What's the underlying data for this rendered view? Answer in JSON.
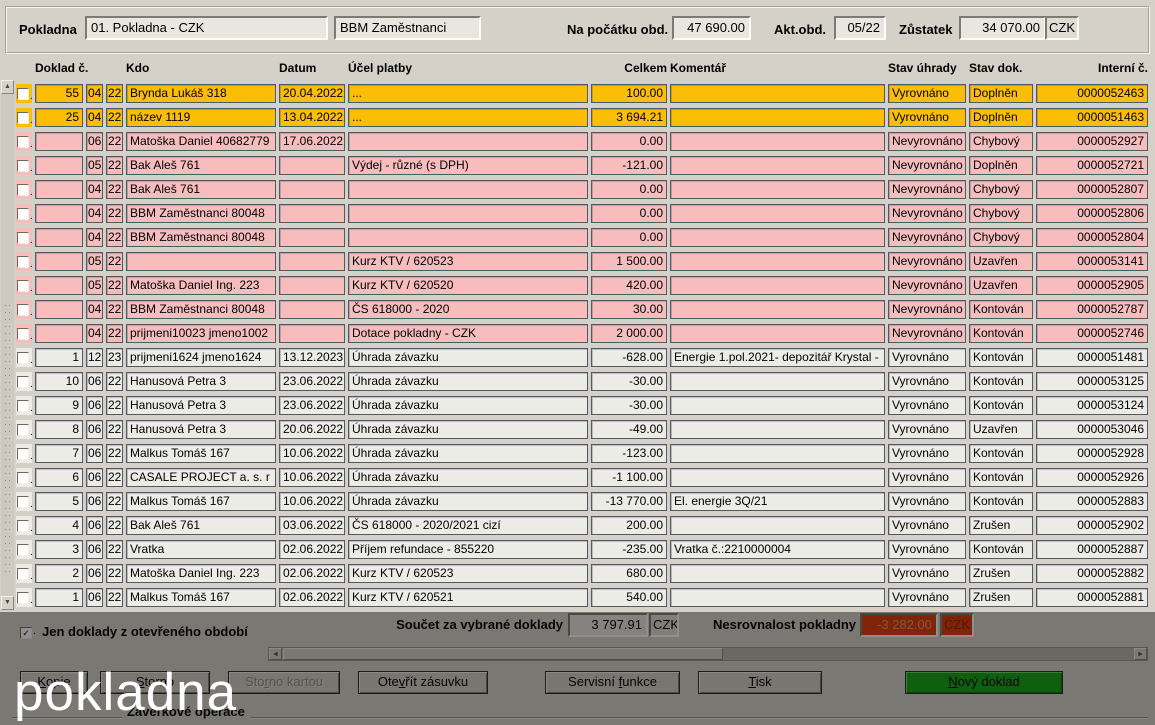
{
  "header": {
    "pokladna_label": "Pokladna",
    "pokladna_value": "01. Pokladna - CZK",
    "owner_value": "BBM Zaměstnanci",
    "opening_label": "Na počátku obd.",
    "opening_value": "47 690.00",
    "period_label": "Akt.obd.",
    "period_value": "05/22",
    "balance_label": "Zůstatek",
    "balance_value": "34 070.00",
    "currency": "CZK"
  },
  "table": {
    "columns": [
      "Doklad č.",
      "Kdo",
      "Datum",
      "Účel platby",
      "Celkem",
      "Komentář",
      "Stav úhrady",
      "Stav dok.",
      "Interní č."
    ],
    "rows": [
      {
        "color": "amber",
        "num": "55",
        "mm": "04",
        "yy": "22",
        "kdo": "Brynda Lukáš 318",
        "datum": "20.04.2022",
        "ucel": "...",
        "celkem": "100.00",
        "komentar": "",
        "uhrada": "Vyrovnáno",
        "dok": "Doplněn",
        "interni": "0000052463"
      },
      {
        "color": "amber",
        "num": "25",
        "mm": "04",
        "yy": "22",
        "kdo": "název 1119",
        "datum": "13.04.2022",
        "ucel": "...",
        "celkem": "3 694.21",
        "komentar": "",
        "uhrada": "Vyrovnáno",
        "dok": "Doplněn",
        "interni": "0000051463"
      },
      {
        "color": "pink",
        "num": "",
        "mm": "06",
        "yy": "22",
        "kdo": "Matoška Daniel 40682779",
        "datum": "17.06.2022",
        "ucel": "",
        "celkem": "0.00",
        "komentar": "",
        "uhrada": "Nevyrovnáno",
        "dok": "Chybový",
        "interni": "0000052927"
      },
      {
        "color": "pink",
        "num": "",
        "mm": "05",
        "yy": "22",
        "kdo": "Bak Aleš 761",
        "datum": "",
        "ucel": "Výdej - různé (s DPH)",
        "celkem": "-121.00",
        "komentar": "",
        "uhrada": "Nevyrovnáno",
        "dok": "Doplněn",
        "interni": "0000052721"
      },
      {
        "color": "pink",
        "num": "",
        "mm": "04",
        "yy": "22",
        "kdo": "Bak Aleš 761",
        "datum": "",
        "ucel": "",
        "celkem": "0.00",
        "komentar": "",
        "uhrada": "Nevyrovnáno",
        "dok": "Chybový",
        "interni": "0000052807"
      },
      {
        "color": "pink",
        "num": "",
        "mm": "04",
        "yy": "22",
        "kdo": "BBM Zaměstnanci 80048",
        "datum": "",
        "ucel": "",
        "celkem": "0.00",
        "komentar": "",
        "uhrada": "Nevyrovnáno",
        "dok": "Chybový",
        "interni": "0000052806"
      },
      {
        "color": "pink",
        "num": "",
        "mm": "04",
        "yy": "22",
        "kdo": "BBM Zaměstnanci 80048",
        "datum": "",
        "ucel": "",
        "celkem": "0.00",
        "komentar": "",
        "uhrada": "Nevyrovnáno",
        "dok": "Chybový",
        "interni": "0000052804"
      },
      {
        "color": "pink",
        "num": "",
        "mm": "05",
        "yy": "22",
        "kdo": "",
        "datum": "",
        "ucel": "Kurz KTV / 620523",
        "celkem": "1 500.00",
        "komentar": "",
        "uhrada": "Nevyrovnáno",
        "dok": "Uzavřen",
        "interni": "0000053141"
      },
      {
        "color": "pink",
        "num": "",
        "mm": "05",
        "yy": "22",
        "kdo": "Matoška Daniel Ing. 223",
        "datum": "",
        "ucel": "Kurz KTV / 620520",
        "celkem": "420.00",
        "komentar": "",
        "uhrada": "Nevyrovnáno",
        "dok": "Uzavřen",
        "interni": "0000052905"
      },
      {
        "color": "pink",
        "num": "",
        "mm": "04",
        "yy": "22",
        "kdo": "BBM Zaměstnanci 80048",
        "datum": "",
        "ucel": "ČS 618000 - 2020",
        "celkem": "30.00",
        "komentar": "",
        "uhrada": "Nevyrovnáno",
        "dok": "Kontován",
        "interni": "0000052787"
      },
      {
        "color": "pink",
        "num": "",
        "mm": "04",
        "yy": "22",
        "kdo": "prijmeni10023 jmeno1002",
        "datum": "",
        "ucel": "Dotace pokladny - CZK",
        "celkem": "2 000.00",
        "komentar": "",
        "uhrada": "Nevyrovnáno",
        "dok": "Kontován",
        "interni": "0000052746"
      },
      {
        "color": "plain",
        "num": "1",
        "mm": "12",
        "yy": "23",
        "kdo": "prijmeni1624 jmeno1624",
        "datum": "13.12.2023",
        "ucel": "Úhrada závazku",
        "celkem": "-628.00",
        "komentar": "Energie 1.pol.2021- depozitář Krystal -",
        "uhrada": "Vyrovnáno",
        "dok": "Kontován",
        "interni": "0000051481"
      },
      {
        "color": "plain",
        "num": "10",
        "mm": "06",
        "yy": "22",
        "kdo": "Hanusová Petra 3",
        "datum": "23.06.2022",
        "ucel": "Úhrada závazku",
        "celkem": "-30.00",
        "komentar": "",
        "uhrada": "Vyrovnáno",
        "dok": "Kontován",
        "interni": "0000053125"
      },
      {
        "color": "plain",
        "num": "9",
        "mm": "06",
        "yy": "22",
        "kdo": "Hanusová Petra 3",
        "datum": "23.06.2022",
        "ucel": "Úhrada závazku",
        "celkem": "-30.00",
        "komentar": "",
        "uhrada": "Vyrovnáno",
        "dok": "Kontován",
        "interni": "0000053124"
      },
      {
        "color": "plain",
        "num": "8",
        "mm": "06",
        "yy": "22",
        "kdo": "Hanusová Petra 3",
        "datum": "20.06.2022",
        "ucel": "Úhrada závazku",
        "celkem": "-49.00",
        "komentar": "",
        "uhrada": "Vyrovnáno",
        "dok": "Uzavřen",
        "interni": "0000053046"
      },
      {
        "color": "plain",
        "num": "7",
        "mm": "06",
        "yy": "22",
        "kdo": "Malkus Tomáš 167",
        "datum": "10.06.2022",
        "ucel": "Úhrada závazku",
        "celkem": "-123.00",
        "komentar": "",
        "uhrada": "Vyrovnáno",
        "dok": "Kontován",
        "interni": "0000052928"
      },
      {
        "color": "plain",
        "num": "6",
        "mm": "06",
        "yy": "22",
        "kdo": "CASALE PROJECT a. s. r",
        "datum": "10.06.2022",
        "ucel": "Úhrada závazku",
        "celkem": "-1 100.00",
        "komentar": "",
        "uhrada": "Vyrovnáno",
        "dok": "Kontován",
        "interni": "0000052926"
      },
      {
        "color": "plain",
        "num": "5",
        "mm": "06",
        "yy": "22",
        "kdo": "Malkus Tomáš 167",
        "datum": "10.06.2022",
        "ucel": "Úhrada závazku",
        "celkem": "-13 770.00",
        "komentar": "El. energie 3Q/21",
        "uhrada": "Vyrovnáno",
        "dok": "Kontován",
        "interni": "0000052883"
      },
      {
        "color": "plain",
        "num": "4",
        "mm": "06",
        "yy": "22",
        "kdo": "Bak Aleš 761",
        "datum": "03.06.2022",
        "ucel": "ČS 618000 - 2020/2021 cizí",
        "celkem": "200.00",
        "komentar": "",
        "uhrada": "Vyrovnáno",
        "dok": "Zrušen",
        "interni": "0000052902"
      },
      {
        "color": "plain",
        "num": "3",
        "mm": "06",
        "yy": "22",
        "kdo": "Vratka",
        "datum": "02.06.2022",
        "ucel": "Příjem refundace - 855220",
        "celkem": "-235.00",
        "komentar": "Vratka č.:2210000004",
        "uhrada": "Vyrovnáno",
        "dok": "Kontován",
        "interni": "0000052887"
      },
      {
        "color": "plain",
        "num": "2",
        "mm": "06",
        "yy": "22",
        "kdo": "Matoška Daniel Ing. 223",
        "datum": "02.06.2022",
        "ucel": "Kurz KTV / 620523",
        "celkem": "680.00",
        "komentar": "",
        "uhrada": "Vyrovnáno",
        "dok": "Zrušen",
        "interni": "0000052882"
      },
      {
        "color": "plain",
        "num": "1",
        "mm": "06",
        "yy": "22",
        "kdo": "Malkus Tomáš 167",
        "datum": "02.06.2022",
        "ucel": "Kurz KTV / 620521",
        "celkem": "540.00",
        "komentar": "",
        "uhrada": "Vyrovnáno",
        "dok": "Zrušen",
        "interni": "0000052881"
      }
    ]
  },
  "footer": {
    "filter_label": "Jen doklady z otevřeného období",
    "filter_checked": true,
    "sum_label": "Součet za vybrané doklady",
    "sum_value": "3 797.91",
    "sum_currency": "CZK",
    "diff_label": "Nesrovnalost pokladny",
    "diff_value": "-3 282.00",
    "diff_currency": "CZK"
  },
  "buttons": [
    {
      "label": "Kopie",
      "accesskey": "K",
      "state": "normal"
    },
    {
      "label": "Storno",
      "accesskey": "S",
      "state": "normal"
    },
    {
      "label": "Storno kartou",
      "accesskey": "r",
      "state": "disabled"
    },
    {
      "label": "Otevřít zásuvku",
      "accesskey": "v",
      "state": "normal"
    },
    {
      "label": "Servisní funkce",
      "accesskey": "f",
      "state": "normal"
    },
    {
      "label": "Tisk",
      "accesskey": "T",
      "state": "normal"
    },
    {
      "label": "Nový doklad",
      "accesskey": "N",
      "state": "primary"
    }
  ],
  "groupbox_label": "Závěrkové operace",
  "overlay_text": "pokladna",
  "colors": {
    "row_amber": "#fcbe04",
    "row_pink": "#f7bcbc",
    "row_plain": "#edebe5",
    "alert_red": "#e13a05",
    "accent_green": "#12a412",
    "window_gray": "#d5d1c8"
  }
}
